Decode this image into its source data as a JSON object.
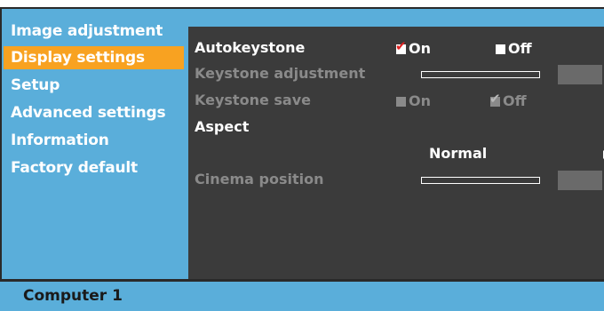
{
  "sidebar": {
    "items": [
      {
        "label": "Image adjustment",
        "active": false
      },
      {
        "label": "Display settings",
        "active": true
      },
      {
        "label": "Setup",
        "active": false
      },
      {
        "label": "Advanced settings",
        "active": false
      },
      {
        "label": "Information",
        "active": false
      },
      {
        "label": "Factory default",
        "active": false
      }
    ]
  },
  "settings": {
    "auto_keystone": {
      "label": "Autokeystone",
      "on_label": "On",
      "on_checked": true,
      "off_label": "Off",
      "off_checked": false
    },
    "keystone_adjustment": {
      "label": "Keystone adjustment",
      "level": 0
    },
    "keystone_save": {
      "label": "Keystone save",
      "on_label": "On",
      "on_checked": false,
      "off_label": "Off",
      "off_checked": true
    },
    "aspect": {
      "label": "Aspect",
      "value": "Normal"
    },
    "cinema_position": {
      "label": "Cinema position",
      "level": 0
    }
  },
  "status": {
    "source": "Computer 1"
  },
  "colors": {
    "panel_blue": "#5aaeda",
    "highlight_orange": "#f8a221",
    "content_gray": "#3b3b3b",
    "disabled_text": "#8a8a8a",
    "check_red": "#e02020"
  }
}
